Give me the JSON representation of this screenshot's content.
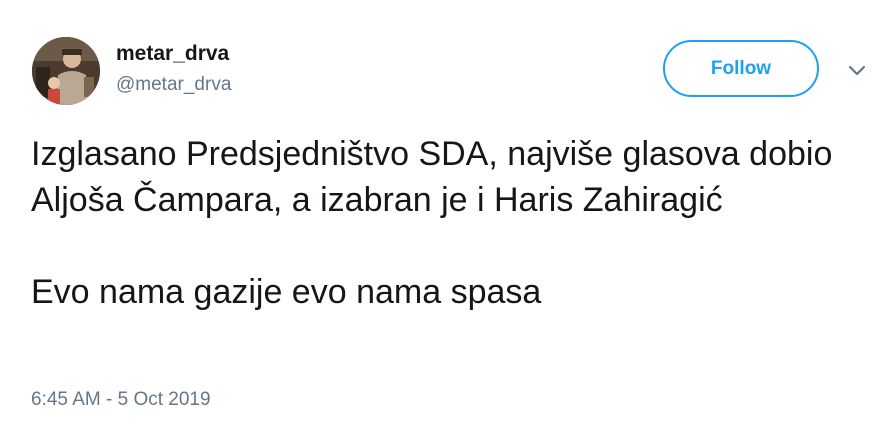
{
  "user": {
    "display_name": "metar_drva",
    "handle": "@metar_drva"
  },
  "actions": {
    "follow_label": "Follow"
  },
  "tweet": {
    "paragraph_1": "Izglasano Predsjedništvo SDA, najviše glasova dobio Aljoša Čampara, a izabran je i Haris Zahiragić",
    "paragraph_2": "Evo nama gazije evo nama spasa",
    "timestamp": "6:45 AM - 5 Oct 2019"
  },
  "icons": {
    "avatar": "avatar-photo",
    "menu": "chevron-down-icon"
  },
  "colors": {
    "accent": "#1da1f2",
    "text": "#14171a",
    "secondary": "#657786"
  }
}
